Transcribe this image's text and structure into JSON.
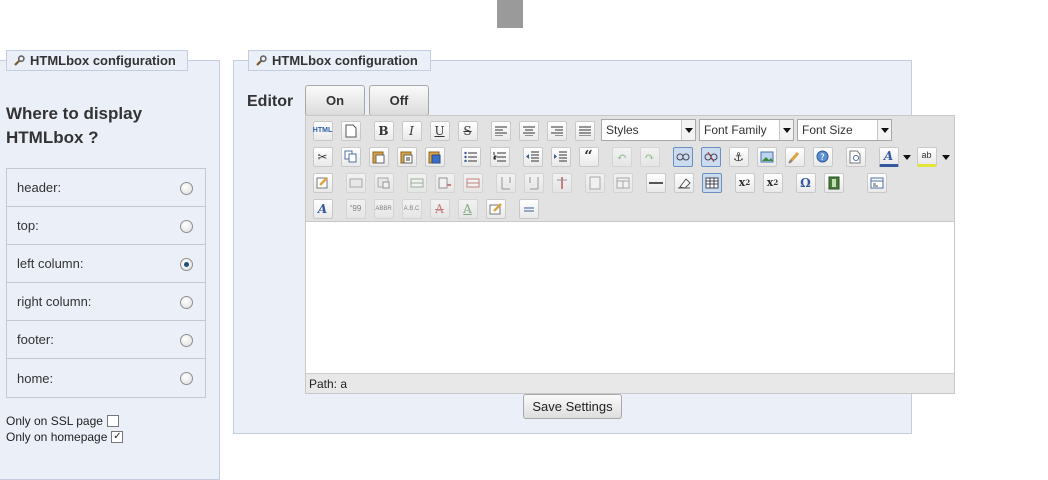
{
  "left_panel": {
    "legend": "HTMLbox configuration",
    "title": "Where to display HTMLbox ?",
    "positions": [
      {
        "label": "header:",
        "checked": false
      },
      {
        "label": "top:",
        "checked": false
      },
      {
        "label": "left column:",
        "checked": true
      },
      {
        "label": "right column:",
        "checked": false
      },
      {
        "label": "footer:",
        "checked": false
      },
      {
        "label": "home:",
        "checked": false
      }
    ],
    "ssl_label": "Only on SSL page",
    "ssl_checked": false,
    "homepage_label": "Only on homepage",
    "homepage_checked": true
  },
  "right_panel": {
    "legend": "HTMLbox configuration",
    "editor_label": "Editor",
    "on_label": "On",
    "off_label": "Off",
    "styles_select": "Styles",
    "font_family_select": "Font Family",
    "font_size_select": "Font Size",
    "status_path": "Path: a",
    "save_label": "Save Settings"
  },
  "icons": {
    "row1": [
      "html-icon",
      "new-document-icon",
      "bold-icon",
      "italic-icon",
      "underline-icon",
      "strikethrough-icon",
      "align-left-icon",
      "align-center-icon",
      "align-right-icon",
      "align-justify-icon"
    ],
    "row2": [
      "cut-icon",
      "copy-icon",
      "paste-icon",
      "paste-text-icon",
      "paste-word-icon",
      "bullet-list-icon",
      "numbered-list-icon",
      "outdent-icon",
      "indent-icon",
      "blockquote-icon",
      "undo-icon",
      "redo-icon",
      "link-icon",
      "unlink-icon",
      "anchor-icon",
      "image-icon",
      "cleanup-icon",
      "help-icon",
      "preview-icon",
      "text-color-icon",
      "highlight-color-icon"
    ],
    "row3": [
      "edit-css-icon",
      "insert-layer-icon",
      "layer-properties-icon",
      "row-before-icon",
      "row-after-icon",
      "delete-row-icon",
      "col-before-icon",
      "col-after-icon",
      "delete-col-icon",
      "split-cells-icon",
      "merge-cells-icon",
      "horizontal-rule-icon",
      "remove-format-icon",
      "visual-aid-icon",
      "subscript-icon",
      "superscript-icon",
      "special-char-icon",
      "media-icon",
      "page-break-icon"
    ],
    "row4": [
      "styleprops-icon",
      "cite-icon",
      "abbr-icon",
      "acronym-icon",
      "del-icon",
      "ins-icon",
      "attributes-icon",
      "non-breaking-icon"
    ]
  },
  "colors": {
    "panel_bg": "#ebeff8",
    "panel_border": "#c4cddf",
    "toolbar_bg": "#e2e2e2",
    "active_button": "#cbdcf0"
  }
}
